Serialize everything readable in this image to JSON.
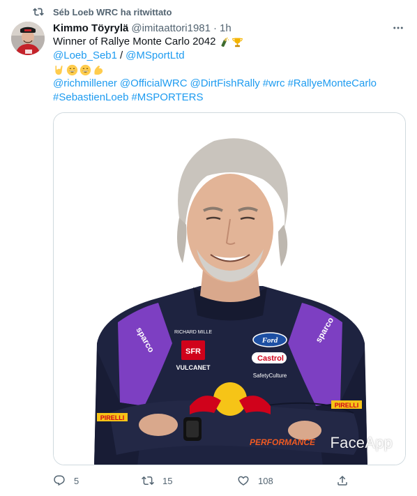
{
  "retweet": {
    "text": "Séb Loeb WRC ha ritwittato",
    "icon": "retweet-icon"
  },
  "author": {
    "name": "Kimmo Töyrylä",
    "handle": "@imitaattori1981",
    "separator": "·",
    "time": "1h"
  },
  "tweet": {
    "line1": "Winner of Rallye Monte Carlo 2042",
    "line1_emojis": [
      "champagne-emoji",
      "trophy-emoji"
    ],
    "mention1": "@Loeb_Seb1",
    "slash": "/",
    "mention2": "@MSportLtd",
    "line3_emojis": [
      "rock-hand-emoji",
      "grinning-emoji",
      "grinning-emoji",
      "flexed-biceps-emoji"
    ],
    "mention3": "@richmillener",
    "mention4": "@OfficialWRC",
    "mention5": "@DirtFishRally",
    "hashtag1": "#wrc",
    "hashtag2": "#RallyeMonteCarlo",
    "hashtag3": "#SebastienLoeb",
    "hashtag4": "#MSPORTERS"
  },
  "media": {
    "watermark": "FaceApp",
    "suit_logos": [
      "sparco",
      "RICHARD MILLE",
      "SFR",
      "VULCANET",
      "Ford",
      "Castrol",
      "Safety Culture",
      "PIRELLI",
      "PERFORMANCE",
      "sparco",
      "PIRELLI"
    ]
  },
  "actions": {
    "reply_count": "5",
    "retweet_count": "15",
    "like_count": "108"
  },
  "colors": {
    "link": "#1d9bf0",
    "secondary": "#536471",
    "border": "#cfd9de"
  }
}
